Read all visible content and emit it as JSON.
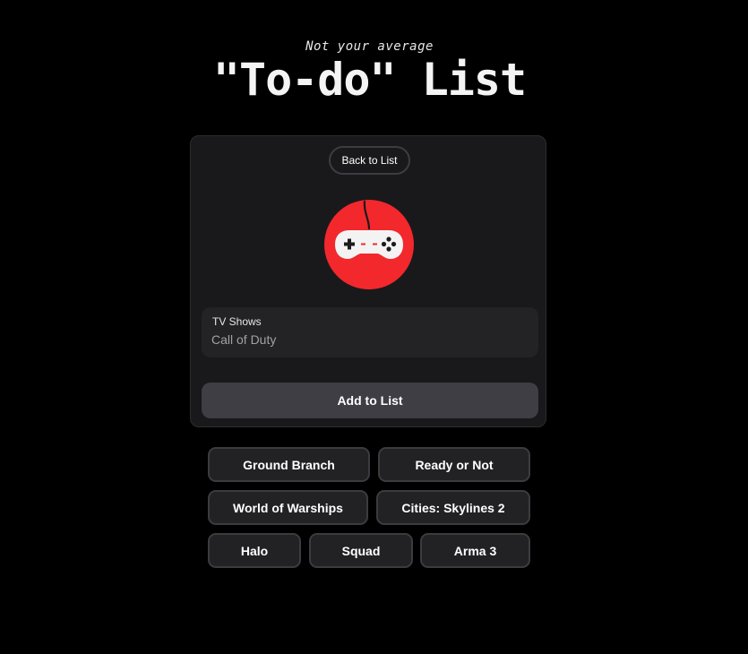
{
  "header": {
    "subtitle": "Not your average",
    "title": "\"To-do\" List"
  },
  "card": {
    "back_label": "Back to List",
    "icon": "game-controller-icon",
    "icon_color": "#f2282d",
    "field": {
      "label": "TV Shows",
      "value": "Call of Duty",
      "placeholder": ""
    },
    "add_label": "Add to List"
  },
  "suggestions": [
    "Ground Branch",
    "Ready or Not",
    "World of Warships",
    "Cities: Skylines 2",
    "Halo",
    "Squad",
    "Arma 3"
  ]
}
